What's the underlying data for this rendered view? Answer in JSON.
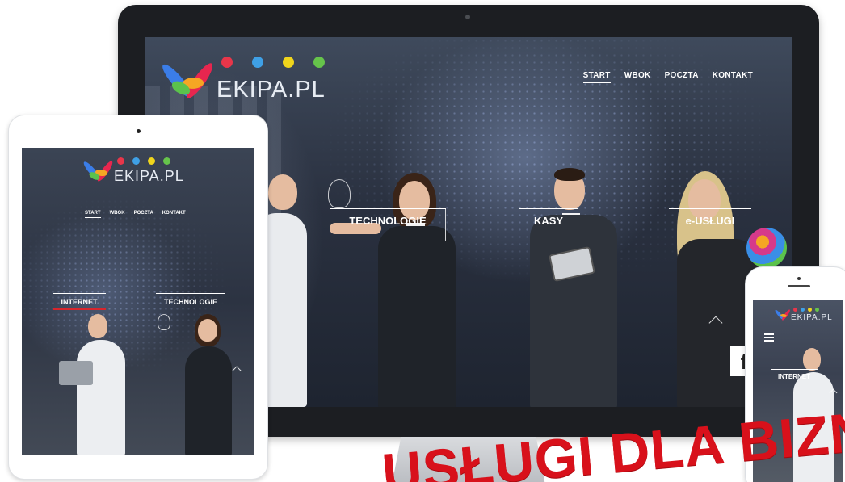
{
  "desktop": {
    "logo_text": "EKIPA.PL",
    "nav": [
      "START",
      "WBOK",
      "POCZTA",
      "KONTAKT"
    ],
    "services": [
      "TECHNOLOGIE",
      "KASY",
      "e-USŁUGI"
    ],
    "facebook_glyph": "f"
  },
  "tablet": {
    "logo_text": "EKIPA.PL",
    "nav": [
      "START",
      "WBOK",
      "POCZTA",
      "KONTAKT"
    ],
    "services": [
      "INTERNET",
      "TECHNOLOGIE"
    ]
  },
  "phone": {
    "logo_text": "EKIPA.PL",
    "services": [
      "INTERNET"
    ]
  },
  "slogan": "USŁUGI DLA BIZNESU",
  "colors": {
    "logo_dots": [
      "#e8364a",
      "#3fa0e6",
      "#f0d51c",
      "#66c44b"
    ],
    "x_mark": [
      "#3b7de8",
      "#e7264f",
      "#f5a623",
      "#5bc24c"
    ],
    "slogan": "#d8111b",
    "active_underline_tablet": "#d8262d"
  }
}
